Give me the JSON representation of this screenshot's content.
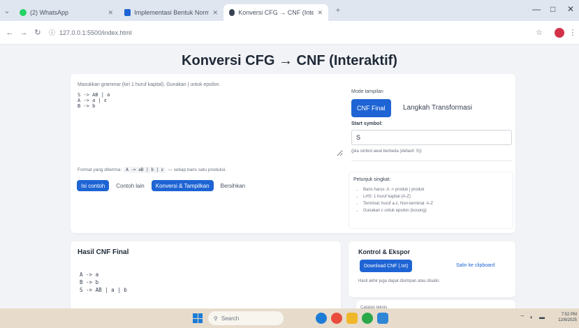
{
  "browser": {
    "tabs": [
      {
        "label": "(2) WhatsApp",
        "favicon_color": "#25d366",
        "active": false
      },
      {
        "label": "Implementasi Bentuk Normal",
        "favicon_color": "#1e64d4",
        "active": false
      },
      {
        "label": "Konversi CFG → CNF (Interaktif)",
        "favicon_color": "#374151",
        "active": true
      }
    ],
    "new_tab": "+",
    "url": "127.0.0.1:5500/index.html",
    "window_controls": {
      "minimize": "—",
      "maximize": "□",
      "close": "✕"
    }
  },
  "page": {
    "title": "Konversi CFG → CNF (Interaktif)",
    "input": {
      "hint": "Masukkan grammar (kiri 1 huruf kapital). Gunakan | untuk epsilon.",
      "grammar": "S -> AB | a\nA -> a | ε\nB -> b",
      "format_label": "Format yang diterima:",
      "format_code_1": "A -> aB | b | ε",
      "format_suffix": "— setiap baris satu produksi.",
      "buttons": {
        "example": "Isi contoh",
        "clear": "Contoh lain",
        "convert": "Konversi & Tampilkan",
        "reset": "Bersihkan"
      }
    },
    "side": {
      "title": "Mode tampilan",
      "tab_cnf": "CNF Final",
      "tab_steps": "Langkah Transformasi",
      "start_label": "Start symbol:",
      "start_value": "S",
      "start_help": "(jika simbol awal berbeda (default: S))"
    },
    "tips": {
      "title": "Petunjuk singkat:",
      "items": [
        "Baris harus: A -> produk | produk",
        "LHS: 1 huruf kapital (A-Z)",
        "Terminal: huruf a-z, Non-terminal: A-Z",
        "Gunakan ε untuk epsilon (kosong)"
      ]
    },
    "cnf": {
      "title": "Hasil CNF Final",
      "output": "A -> a\nB -> b\nS -> AB | a | b"
    },
    "control": {
      "title": "Kontrol & Ekspor",
      "download": "Download CNF (.txt)",
      "copy": "Salin ke clipboard",
      "note": "Hasil akhir juga dapat disimpan atau disalin."
    },
    "peek": {
      "label": "Catatan teknis"
    }
  },
  "taskbar": {
    "search": "Search",
    "time": "7:52 PM",
    "date": "12/8/2025"
  },
  "colors": {
    "accent": "#1e64d4",
    "taskbar": "#e7dccb"
  }
}
